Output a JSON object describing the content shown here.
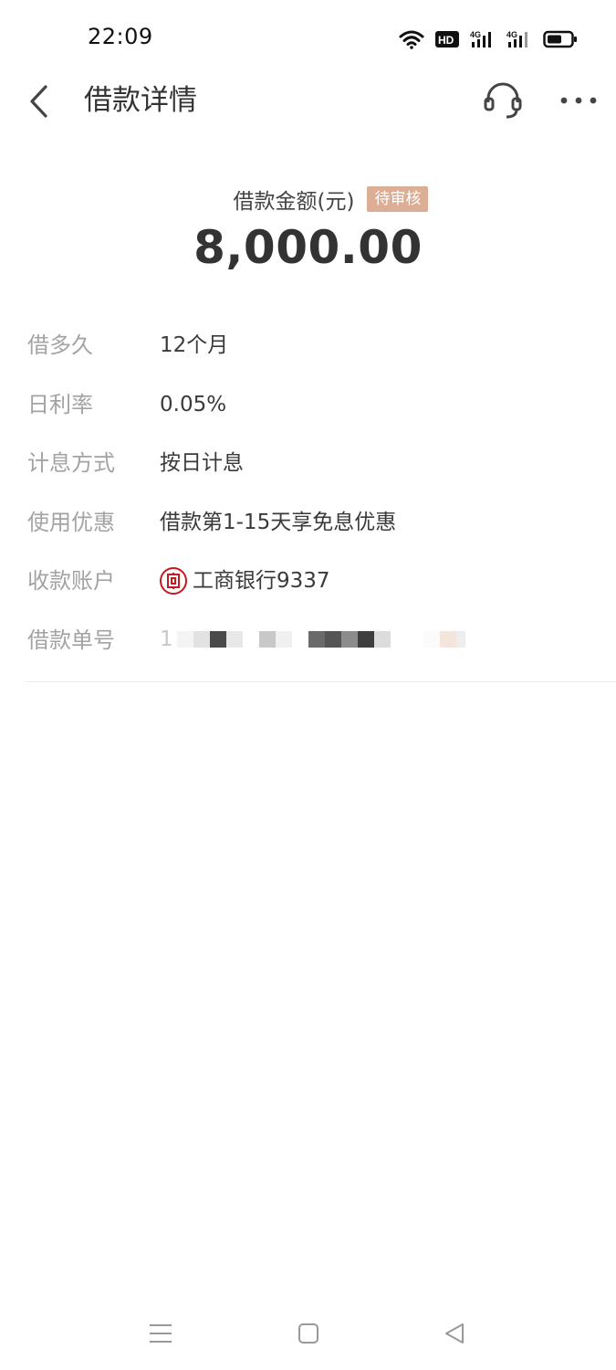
{
  "status_bar": {
    "time": "22:09",
    "icons": [
      "wifi-icon",
      "hd-icon",
      "signal-4g-icon",
      "signal-4g-icon",
      "battery-icon"
    ],
    "hd_text": "HD",
    "network_1": "4G",
    "network_2": "4G"
  },
  "header": {
    "title": "借款详情",
    "back_icon": "chevron-left-icon",
    "support_icon": "headset-icon",
    "more_icon": "more-dots-icon"
  },
  "amount": {
    "label": "借款金额(元)",
    "status": "待审核",
    "value": "8,000.00"
  },
  "details": [
    {
      "label": "借多久",
      "value": "12个月"
    },
    {
      "label": "日利率",
      "value": "0.05%"
    },
    {
      "label": "计息方式",
      "value": "按日计息"
    },
    {
      "label": "使用优惠",
      "value": "借款第1-15天享免息优惠"
    },
    {
      "label": "收款账户",
      "value": "工商银行9337",
      "bank_icon": "icbc-logo-icon"
    },
    {
      "label": "借款单号",
      "value": "1"
    }
  ],
  "colors": {
    "badge": "#dcae95",
    "bank_red": "#c8171e",
    "label_gray": "#a3a3a3"
  },
  "nav": {
    "icons": [
      "menu-icon",
      "home-icon",
      "back-triangle-icon"
    ]
  }
}
